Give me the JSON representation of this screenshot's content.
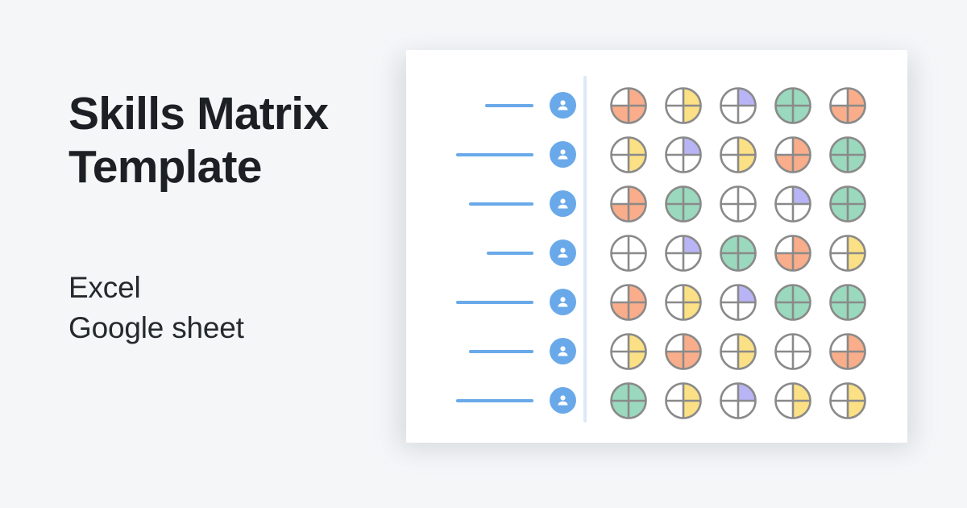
{
  "page": {
    "background_color": "#f4f6f8"
  },
  "left_panel": {
    "title": "Skills Matrix\nTemplate",
    "title_color": "#1c2024",
    "formats": [
      {
        "label": "Excel"
      },
      {
        "label": "Google sheet"
      }
    ],
    "formats_color": "#24292e"
  },
  "card": {
    "background_color": "#ffffff",
    "divider_color": "#dce9f7",
    "accent_blue": "#6aa9e9",
    "circle_stroke": "#8a8a8a"
  },
  "legend_colors": {
    "orange": "#f9ad8a",
    "yellow": "#fbe085",
    "green": "#9ad9be",
    "purple": "#b8b4f5",
    "empty": "#ffffff"
  },
  "matrix": {
    "row_count": 7,
    "column_count": 5,
    "avatar_icon": "person-icon",
    "rows": [
      {
        "name_line_width": 60,
        "avatar": "person-icon",
        "cells": [
          {
            "level": "orange-3q",
            "color": "#f9ad8a",
            "quadrants": [
              "empty",
              "fill",
              "fill",
              "fill"
            ]
          },
          {
            "level": "yellow-half",
            "color": "#fbe085",
            "quadrants": [
              "empty",
              "fill",
              "fill",
              "empty"
            ]
          },
          {
            "level": "purple-1q",
            "color": "#b8b4f5",
            "quadrants": [
              "empty",
              "fill",
              "empty",
              "empty"
            ]
          },
          {
            "level": "green-full",
            "color": "#9ad9be",
            "quadrants": [
              "fill",
              "fill",
              "fill",
              "fill"
            ]
          },
          {
            "level": "orange-3q",
            "color": "#f9ad8a",
            "quadrants": [
              "empty",
              "fill",
              "fill",
              "fill"
            ]
          }
        ]
      },
      {
        "name_line_width": 96,
        "avatar": "person-icon",
        "cells": [
          {
            "level": "yellow-half",
            "color": "#fbe085",
            "quadrants": [
              "empty",
              "fill",
              "fill",
              "empty"
            ]
          },
          {
            "level": "purple-1q",
            "color": "#b8b4f5",
            "quadrants": [
              "empty",
              "fill",
              "empty",
              "empty"
            ]
          },
          {
            "level": "yellow-half",
            "color": "#fbe085",
            "quadrants": [
              "empty",
              "fill",
              "fill",
              "empty"
            ]
          },
          {
            "level": "orange-3q",
            "color": "#f9ad8a",
            "quadrants": [
              "empty",
              "fill",
              "fill",
              "fill"
            ]
          },
          {
            "level": "green-full",
            "color": "#9ad9be",
            "quadrants": [
              "fill",
              "fill",
              "fill",
              "fill"
            ]
          }
        ]
      },
      {
        "name_line_width": 80,
        "avatar": "person-icon",
        "cells": [
          {
            "level": "orange-3q",
            "color": "#f9ad8a",
            "quadrants": [
              "empty",
              "fill",
              "fill",
              "fill"
            ]
          },
          {
            "level": "green-full",
            "color": "#9ad9be",
            "quadrants": [
              "fill",
              "fill",
              "fill",
              "fill"
            ]
          },
          {
            "level": "empty",
            "color": "#ffffff",
            "quadrants": [
              "empty",
              "empty",
              "empty",
              "empty"
            ]
          },
          {
            "level": "purple-1q",
            "color": "#b8b4f5",
            "quadrants": [
              "empty",
              "fill",
              "empty",
              "empty"
            ]
          },
          {
            "level": "green-full",
            "color": "#9ad9be",
            "quadrants": [
              "fill",
              "fill",
              "fill",
              "fill"
            ]
          }
        ]
      },
      {
        "name_line_width": 58,
        "avatar": "person-icon",
        "cells": [
          {
            "level": "empty",
            "color": "#ffffff",
            "quadrants": [
              "empty",
              "empty",
              "empty",
              "empty"
            ]
          },
          {
            "level": "purple-1q",
            "color": "#b8b4f5",
            "quadrants": [
              "empty",
              "fill",
              "empty",
              "empty"
            ]
          },
          {
            "level": "green-full",
            "color": "#9ad9be",
            "quadrants": [
              "fill",
              "fill",
              "fill",
              "fill"
            ]
          },
          {
            "level": "orange-3q",
            "color": "#f9ad8a",
            "quadrants": [
              "empty",
              "fill",
              "fill",
              "fill"
            ]
          },
          {
            "level": "yellow-half",
            "color": "#fbe085",
            "quadrants": [
              "empty",
              "fill",
              "fill",
              "empty"
            ]
          }
        ]
      },
      {
        "name_line_width": 96,
        "avatar": "person-icon",
        "cells": [
          {
            "level": "orange-3q",
            "color": "#f9ad8a",
            "quadrants": [
              "empty",
              "fill",
              "fill",
              "fill"
            ]
          },
          {
            "level": "yellow-half",
            "color": "#fbe085",
            "quadrants": [
              "empty",
              "fill",
              "fill",
              "empty"
            ]
          },
          {
            "level": "purple-1q",
            "color": "#b8b4f5",
            "quadrants": [
              "empty",
              "fill",
              "empty",
              "empty"
            ]
          },
          {
            "level": "green-full",
            "color": "#9ad9be",
            "quadrants": [
              "fill",
              "fill",
              "fill",
              "fill"
            ]
          },
          {
            "level": "green-full",
            "color": "#9ad9be",
            "quadrants": [
              "fill",
              "fill",
              "fill",
              "fill"
            ]
          }
        ]
      },
      {
        "name_line_width": 80,
        "avatar": "person-icon",
        "cells": [
          {
            "level": "yellow-half",
            "color": "#fbe085",
            "quadrants": [
              "empty",
              "fill",
              "fill",
              "empty"
            ]
          },
          {
            "level": "orange-3q",
            "color": "#f9ad8a",
            "quadrants": [
              "empty",
              "fill",
              "fill",
              "fill"
            ]
          },
          {
            "level": "yellow-half",
            "color": "#fbe085",
            "quadrants": [
              "empty",
              "fill",
              "fill",
              "empty"
            ]
          },
          {
            "level": "empty",
            "color": "#ffffff",
            "quadrants": [
              "empty",
              "empty",
              "empty",
              "empty"
            ]
          },
          {
            "level": "orange-3q",
            "color": "#f9ad8a",
            "quadrants": [
              "empty",
              "fill",
              "fill",
              "fill"
            ]
          }
        ]
      },
      {
        "name_line_width": 96,
        "avatar": "person-icon",
        "cells": [
          {
            "level": "green-full",
            "color": "#9ad9be",
            "quadrants": [
              "fill",
              "fill",
              "fill",
              "fill"
            ]
          },
          {
            "level": "yellow-half",
            "color": "#fbe085",
            "quadrants": [
              "empty",
              "fill",
              "fill",
              "empty"
            ]
          },
          {
            "level": "purple-1q",
            "color": "#b8b4f5",
            "quadrants": [
              "empty",
              "fill",
              "empty",
              "empty"
            ]
          },
          {
            "level": "yellow-half",
            "color": "#fbe085",
            "quadrants": [
              "empty",
              "fill",
              "fill",
              "empty"
            ]
          },
          {
            "level": "yellow-half",
            "color": "#fbe085",
            "quadrants": [
              "empty",
              "fill",
              "fill",
              "empty"
            ]
          }
        ]
      }
    ]
  }
}
